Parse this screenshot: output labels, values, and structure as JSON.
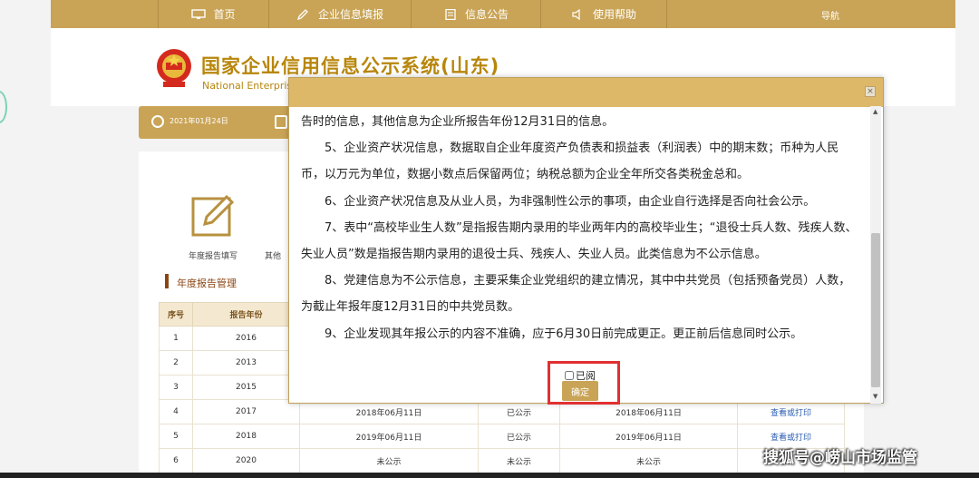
{
  "nav": {
    "home": "首页",
    "fill": "企业信息填报",
    "notice": "信息公告",
    "help": "使用帮助",
    "guide": "导航"
  },
  "header": {
    "title": "国家企业信用信息公示系统(山东)",
    "subtitle": "National Enterprise"
  },
  "datebar": {
    "date": "2021年01月24日"
  },
  "tiles": {
    "annual": "年度报告填写",
    "other": "其他"
  },
  "section": {
    "title": "年度报告管理"
  },
  "table": {
    "headers": [
      "序号",
      "报告年份",
      "",
      "",
      "",
      ""
    ],
    "rows": [
      [
        "1",
        "2016",
        "",
        "",
        "",
        ""
      ],
      [
        "2",
        "2013",
        "",
        "",
        "",
        ""
      ],
      [
        "3",
        "2015",
        "",
        "",
        "",
        ""
      ],
      [
        "4",
        "2017",
        "2018年06月11日",
        "已公示",
        "2018年06月11日",
        "查看或打印"
      ],
      [
        "5",
        "2018",
        "2019年06月11日",
        "已公示",
        "2019年06月11日",
        "查看或打印"
      ],
      [
        "6",
        "2020",
        "未公示",
        "未公示",
        "未公示",
        ""
      ]
    ]
  },
  "modal": {
    "lines": [
      "告时的信息，其他信息为企业所报告年份12月31日的信息。",
      "5、企业资产状况信息，数据取自企业年度资产负债表和损益表（利润表）中的期末数；币种为人民",
      "币，以万元为单位，数据小数点后保留两位；纳税总额为企业全年所交各类税金总和。",
      "6、企业资产状况信息及从业人员，为非强制性公示的事项，由企业自行选择是否向社会公示。",
      "7、表中“高校毕业生人数”是指报告期内录用的毕业两年内的高校毕业生；“退役士兵人数、残疾人数、",
      "失业人员”数是指报告期内录用的退役士兵、残疾人、失业人员。此类信息为不公示信息。",
      "8、党建信息为不公示信息，主要采集企业党组织的建立情况，其中中共党员（包括预备党员）人数，",
      "为截止年报年度12月31日的中共党员数。",
      "9、企业发现其年报公示的内容不准确，应于6月30日前完成更正。更正前后信息同时公示。"
    ],
    "read_label": "已阅",
    "confirm": "确定",
    "close": "×"
  },
  "watermark": "搜狐号@崂山市场监管",
  "colors": {
    "gold": "#c9a456",
    "header_gold": "#ddb868",
    "brand_text": "#b8860b",
    "highlight": "#e03030"
  }
}
